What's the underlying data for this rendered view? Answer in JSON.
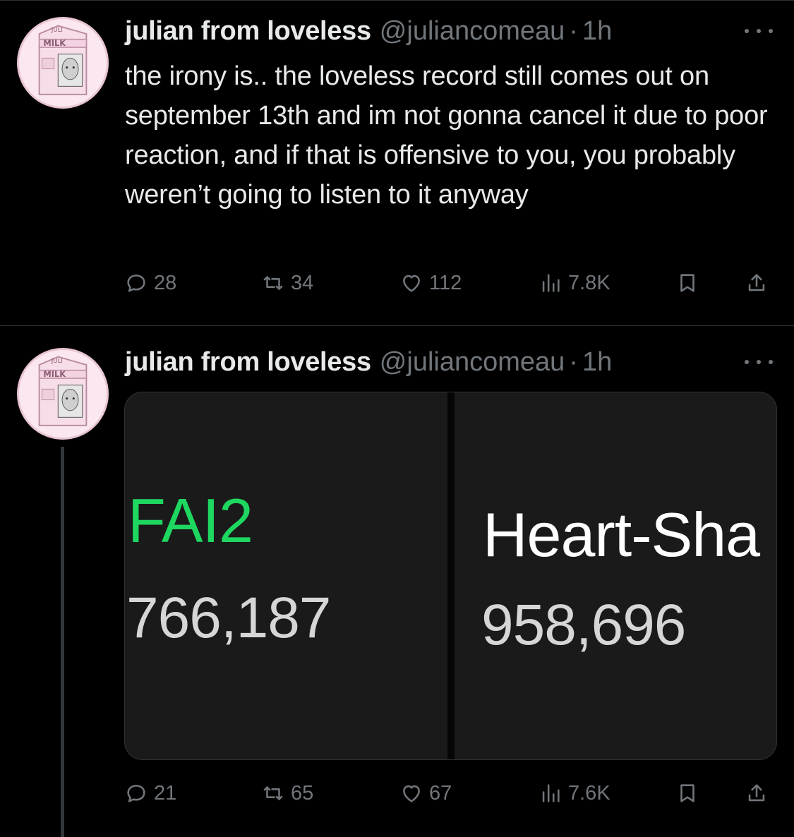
{
  "tweets": [
    {
      "author": {
        "name": "julian from loveless",
        "handle": "@juliancomeau",
        "time": "1h"
      },
      "text": "the irony is.. the loveless record still comes out on september 13th and im not gonna cancel it due to poor reaction, and if that is offensive to you, you probably weren’t going to listen to it anyway",
      "stats": {
        "replies": "28",
        "retweets": "34",
        "likes": "112",
        "views": "7.8K"
      }
    },
    {
      "author": {
        "name": "julian from loveless",
        "handle": "@juliancomeau",
        "time": "1h"
      },
      "media": {
        "left": {
          "title": "FAI2",
          "count": "766,187",
          "title_color": "#1ed760"
        },
        "right": {
          "title": "Heart-Sha",
          "count": "958,696",
          "title_color": "#ffffff"
        }
      },
      "stats": {
        "replies": "21",
        "retweets": "65",
        "likes": "67",
        "views": "7.6K"
      }
    }
  ],
  "avatar": {
    "icon": "milk-carton-avatar",
    "label_top": "JULI",
    "label_main": "MILK",
    "colors": {
      "bg": "#fbe7ef",
      "accent": "#c9a0b4"
    }
  },
  "colors": {
    "background": "#000000",
    "text": "#e7e9ea",
    "muted": "#71767b",
    "border": "#2f3336",
    "spotify_green": "#1ed760"
  },
  "icons": {
    "reply": "reply-icon",
    "retweet": "retweet-icon",
    "like": "heart-icon",
    "views": "views-icon",
    "bookmark": "bookmark-icon",
    "share": "share-icon",
    "more": "more-icon"
  }
}
